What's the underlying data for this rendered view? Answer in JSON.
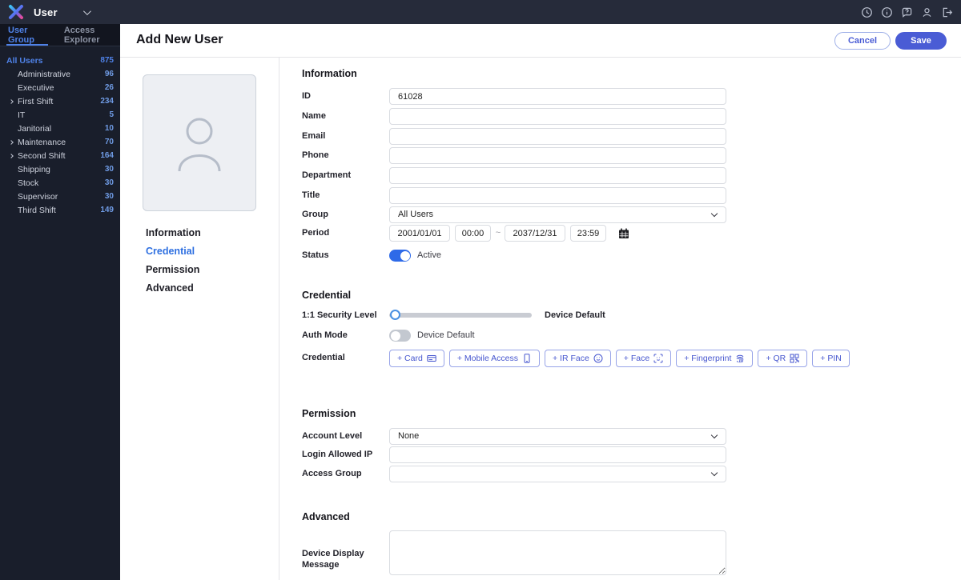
{
  "topbar": {
    "menu_label": "User",
    "icons": [
      "clock-icon",
      "info-icon",
      "help-icon",
      "user-icon",
      "logout-icon"
    ]
  },
  "sidebar": {
    "tabs": [
      {
        "label": "User Group",
        "active": true
      },
      {
        "label": "Access Explorer",
        "active": false
      }
    ],
    "groups": [
      {
        "name": "All Users",
        "count": "875",
        "level": 0,
        "expandable": false,
        "active": true
      },
      {
        "name": "Administrative",
        "count": "96",
        "level": 1,
        "expandable": false
      },
      {
        "name": "Executive",
        "count": "26",
        "level": 1,
        "expandable": false
      },
      {
        "name": "First Shift",
        "count": "234",
        "level": 1,
        "expandable": true
      },
      {
        "name": "IT",
        "count": "5",
        "level": 1,
        "expandable": false
      },
      {
        "name": "Janitorial",
        "count": "10",
        "level": 1,
        "expandable": false
      },
      {
        "name": "Maintenance",
        "count": "70",
        "level": 1,
        "expandable": true
      },
      {
        "name": "Second Shift",
        "count": "164",
        "level": 1,
        "expandable": true
      },
      {
        "name": "Shipping",
        "count": "30",
        "level": 1,
        "expandable": false
      },
      {
        "name": "Stock",
        "count": "30",
        "level": 1,
        "expandable": false
      },
      {
        "name": "Supervisor",
        "count": "30",
        "level": 1,
        "expandable": false
      },
      {
        "name": "Third Shift",
        "count": "149",
        "level": 1,
        "expandable": false
      }
    ]
  },
  "header": {
    "title": "Add New User",
    "cancel": "Cancel",
    "save": "Save"
  },
  "profile_nav": {
    "items": [
      {
        "label": "Information",
        "active": false
      },
      {
        "label": "Credential",
        "active": true
      },
      {
        "label": "Permission",
        "active": false
      },
      {
        "label": "Advanced",
        "active": false
      }
    ]
  },
  "form": {
    "information": {
      "title": "Information",
      "rows": [
        {
          "label": "ID",
          "value": "61028"
        },
        {
          "label": "Name",
          "value": ""
        },
        {
          "label": "Email",
          "value": ""
        },
        {
          "label": "Phone",
          "value": ""
        },
        {
          "label": "Department",
          "value": ""
        },
        {
          "label": "Title",
          "value": ""
        }
      ],
      "group": {
        "label": "Group",
        "value": "All Users"
      },
      "period": {
        "label": "Period",
        "start_date": "2001/01/01",
        "start_time": "00:00",
        "tilde": "~",
        "end_date": "2037/12/31",
        "end_time": "23:59"
      },
      "status": {
        "label": "Status",
        "value": "Active",
        "on": true
      }
    },
    "credential": {
      "title": "Credential",
      "security_level": {
        "label": "1:1 Security Level",
        "value": "Device Default"
      },
      "auth_mode": {
        "label": "Auth Mode",
        "value": "Device Default",
        "on": false
      },
      "buttons_label": "Credential",
      "buttons": [
        {
          "label": "+ Card",
          "icon": "card-icon"
        },
        {
          "label": "+ Mobile Access",
          "icon": "mobile-icon"
        },
        {
          "label": "+ IR Face",
          "icon": "ir-face-icon"
        },
        {
          "label": "+ Face",
          "icon": "face-scan-icon"
        },
        {
          "label": "+ Fingerprint",
          "icon": "fingerprint-icon"
        },
        {
          "label": "+ QR",
          "icon": "qr-icon"
        },
        {
          "label": "+ PIN",
          "icon": null
        }
      ]
    },
    "permission": {
      "title": "Permission",
      "account_level": {
        "label": "Account Level",
        "value": "None"
      },
      "login_allowed_ip": {
        "label": "Login Allowed IP",
        "value": ""
      },
      "access_group": {
        "label": "Access Group",
        "value": ""
      }
    },
    "advanced": {
      "title": "Advanced",
      "device_display_message": {
        "label": "Device Display Message",
        "value": ""
      }
    }
  },
  "colors": {
    "accent": "#4a5cd5",
    "topbar_bg": "#262b3a",
    "sidebar_bg": "#191e2b",
    "link_blue": "#4f82e8",
    "toggle_on": "#2e6ae8"
  }
}
